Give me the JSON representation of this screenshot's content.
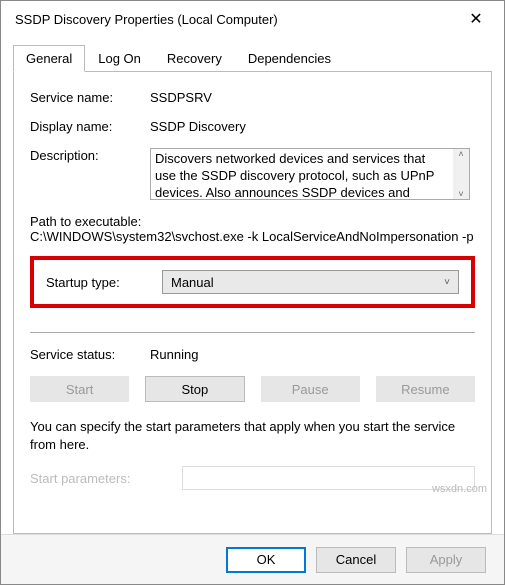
{
  "window_title": "SSDP Discovery Properties (Local Computer)",
  "tabs": [
    "General",
    "Log On",
    "Recovery",
    "Dependencies"
  ],
  "labels": {
    "service_name": "Service name:",
    "display_name": "Display name:",
    "description": "Description:",
    "path": "Path to executable:",
    "startup_type": "Startup type:",
    "service_status": "Service status:",
    "start_params": "Start parameters:"
  },
  "values": {
    "service_name": "SSDPSRV",
    "display_name": "SSDP Discovery",
    "description": "Discovers networked devices and services that use the SSDP discovery protocol, such as UPnP devices. Also announces SSDP devices and services running",
    "path": "C:\\WINDOWS\\system32\\svchost.exe -k LocalServiceAndNoImpersonation -p",
    "startup_type": "Manual",
    "service_status": "Running"
  },
  "svc_buttons": {
    "start": "Start",
    "stop": "Stop",
    "pause": "Pause",
    "resume": "Resume"
  },
  "hint": "You can specify the start parameters that apply when you start the service from here.",
  "dlg_buttons": {
    "ok": "OK",
    "cancel": "Cancel",
    "apply": "Apply"
  },
  "watermark": "wsxdn.com"
}
